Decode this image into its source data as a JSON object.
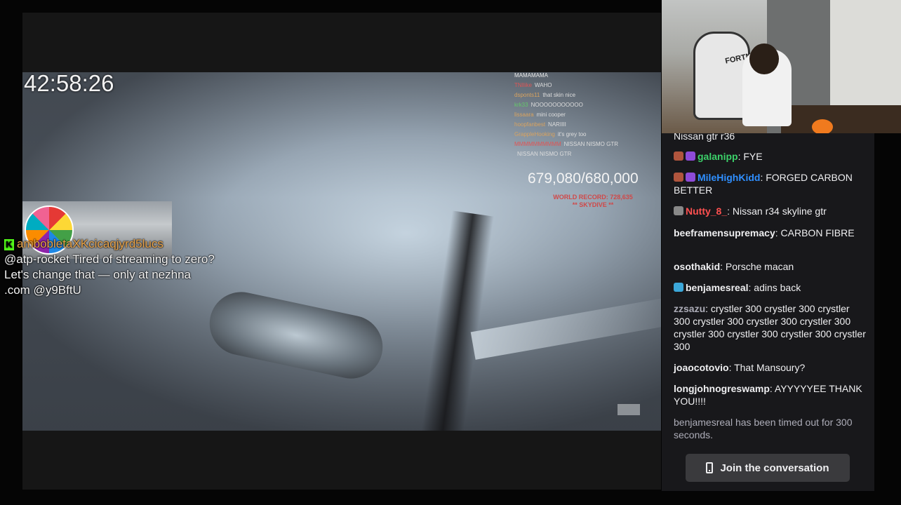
{
  "stream": {
    "timer": "42:58:26",
    "counter": "679,080/680,000",
    "record_line1": "WORLD RECORD: 728,635",
    "record_line2": "** SKYDIVE **",
    "mini_chat": [
      {
        "user": "MAMAMAMA",
        "text": "",
        "color": "#e8e8e8"
      },
      {
        "user": "TNIlike",
        "text": "WAHO",
        "color": "#e05555"
      },
      {
        "user": "dsponts11",
        "text": "that skin nice",
        "color": "#d9a35f"
      },
      {
        "user": "krk33",
        "text": "NOOOOOOOOOOO",
        "color": "#65c76b"
      },
      {
        "user": "lissaara",
        "text": "mini cooper",
        "color": "#d9a35f"
      },
      {
        "user": "hoopfanbest",
        "text": "NARIIII",
        "color": "#d9a35f"
      },
      {
        "user": "GrappleHooking",
        "text": "it's grey too",
        "color": "#d9a35f"
      },
      {
        "user": "MMMMMMMMMM",
        "text": "NISSAN NISMO GTR",
        "color": "#e05555"
      },
      {
        "user": "",
        "text": "NISSAN NISMO GTR",
        "color": "#e8e8e8"
      }
    ],
    "kick_alert": {
      "username": "ambobletaXKcicaqjyrd5lucs",
      "message": "@atp-rocket Tired of streaming to zero? Let's change that — only at nezhna .com @y9BftU"
    }
  },
  "webcam": {
    "chair_text": "FORTNITE"
  },
  "chat": {
    "messages": [
      {
        "user": "",
        "text": "Nissan gtr r36",
        "color": "#e05555",
        "badges": []
      },
      {
        "user": "galanipp",
        "text": "FYE",
        "color": "#3cd16a",
        "badges": [
          "#b0553d",
          "#8e4bd8"
        ]
      },
      {
        "user": "MileHighKidd",
        "text": "FORGED CARBON BETTER",
        "color": "#2f8fff",
        "badges": [
          "#b0553d",
          "#8e4bd8"
        ]
      },
      {
        "user": "Nutty_8_",
        "text": "Nissan r34 skyline gtr",
        "color": "#ff5050",
        "badges": [
          "#888888"
        ]
      },
      {
        "user": "beeframensupremacy",
        "text": "CARBON FIBRE",
        "color": "#efeff1",
        "badges": []
      },
      {
        "user": "osothakid",
        "text": "Porsche macan",
        "color": "#efeff1",
        "badges": []
      },
      {
        "user": "benjamesreal",
        "text": "adins back",
        "color": "#efeff1",
        "badges": [
          "#3ba7d9"
        ]
      },
      {
        "user": "zzsazu",
        "text": "crystler 300 crystler 300 crystler 300 crystler 300 crystler 300 crystler 300 crystler 300 crystler 300 crystler 300 crystler 300",
        "color": "#adadb8",
        "badges": []
      },
      {
        "user": "joaocotovio",
        "text": "That Mansoury?",
        "color": "#efeff1",
        "badges": []
      },
      {
        "user": "longjohnogreswamp",
        "text": "AYYYYYEE THANK YOU!!!!",
        "color": "#efeff1",
        "badges": []
      }
    ],
    "system_message": "benjamesreal has been timed out for 300 seconds.",
    "join_label": "Join the conversation"
  }
}
